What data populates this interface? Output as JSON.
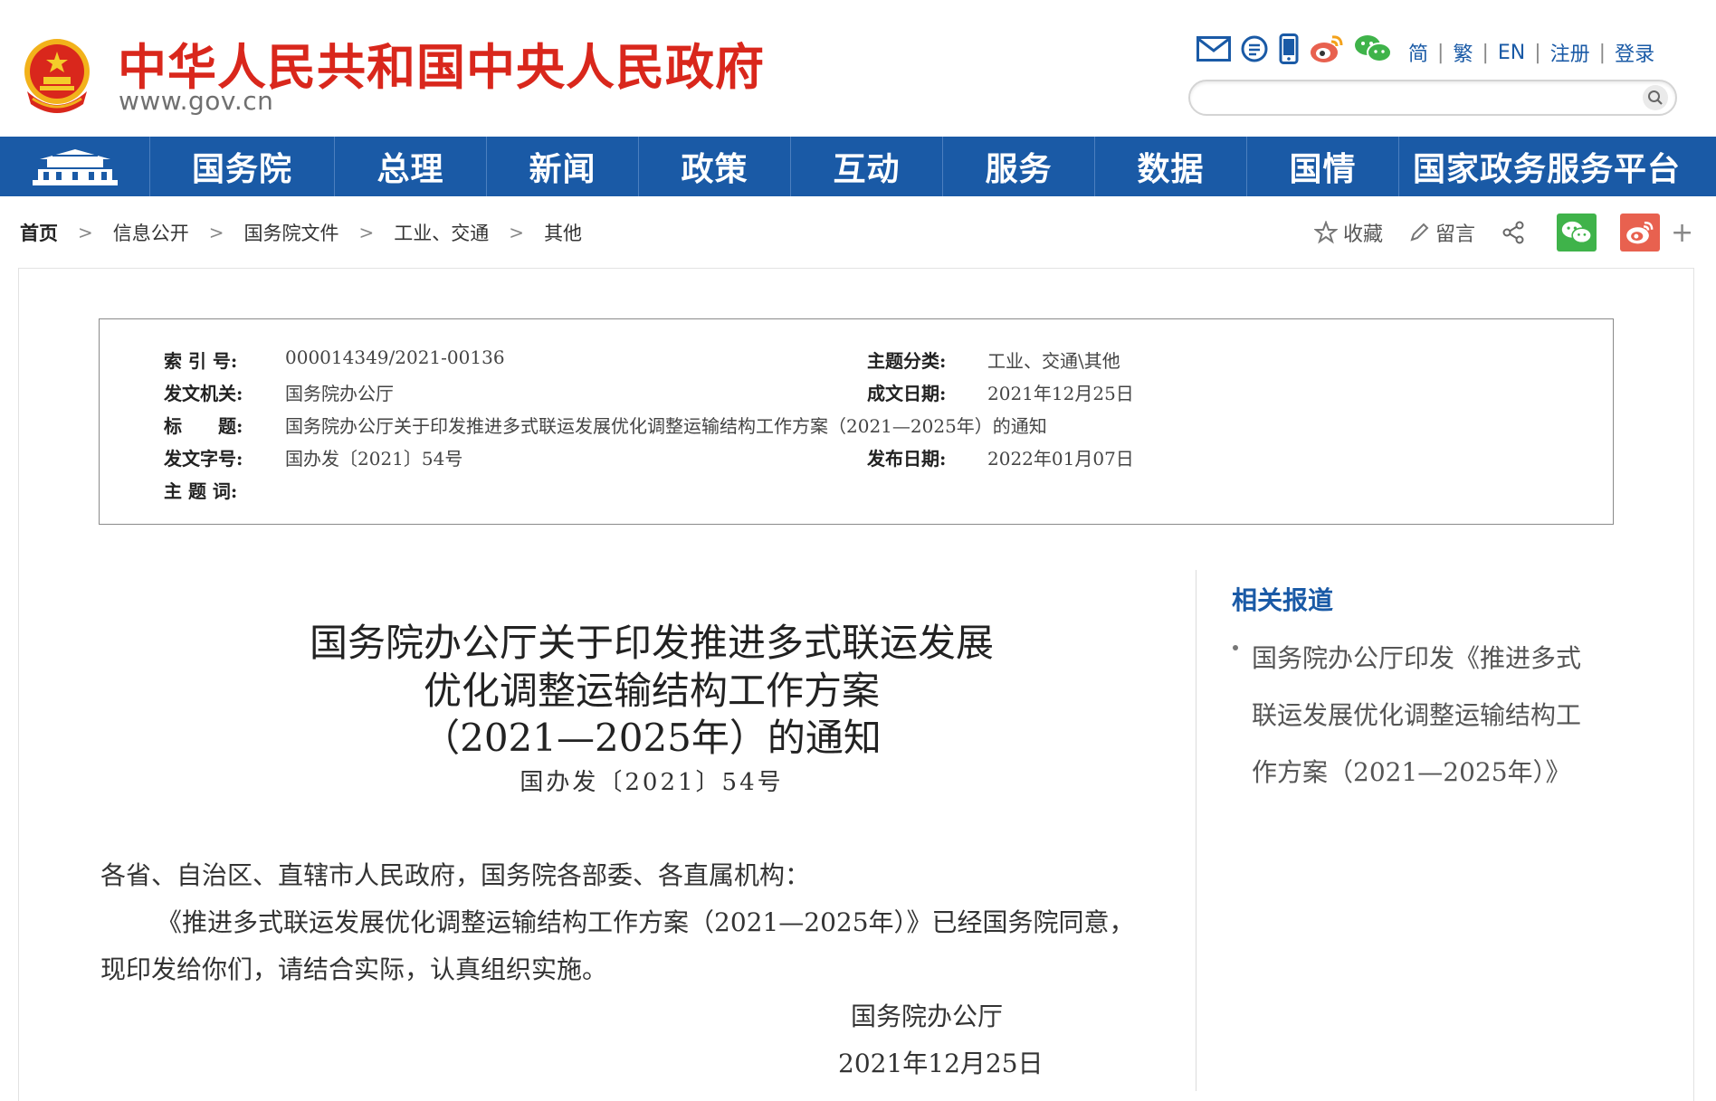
{
  "header": {
    "site_title": "中华人民共和国中央人民政府",
    "site_domain": "www.gov.cn",
    "icons": [
      "mail-icon",
      "message-icon",
      "mobile-icon",
      "weibo-icon",
      "wechat-icon"
    ],
    "lang_links": [
      "简",
      "繁",
      "EN"
    ],
    "register_label": "注册",
    "login_label": "登录",
    "search_placeholder": ""
  },
  "nav": {
    "items": [
      "国务院",
      "总理",
      "新闻",
      "政策",
      "互动",
      "服务",
      "数据",
      "国情",
      "国家政务服务平台"
    ]
  },
  "breadcrumb": {
    "items": [
      "首页",
      "信息公开",
      "国务院文件",
      "工业、交通",
      "其他"
    ]
  },
  "tools": {
    "favorite_label": "收藏",
    "comment_label": "留言",
    "plus_label": "+"
  },
  "meta": {
    "index_label": "索 引 号:",
    "index_value": "000014349/2021-00136",
    "topic_label": "主题分类:",
    "topic_value": "工业、交通\\其他",
    "issuer_label": "发文机关:",
    "issuer_value": "国务院办公厅",
    "written_label": "成文日期:",
    "written_value": "2021年12月25日",
    "title_label": "标　　题:",
    "title_value": "国务院办公厅关于印发推进多式联运发展优化调整运输结构工作方案（2021—2025年）的通知",
    "docno_label": "发文字号:",
    "docno_value": "国办发〔2021〕54号",
    "publish_label": "发布日期:",
    "publish_value": "2022年01月07日",
    "keywords_label": "主 题 词:",
    "keywords_value": ""
  },
  "document": {
    "title_line1": "国务院办公厅关于印发推进多式联运发展",
    "title_line2": "优化调整运输结构工作方案",
    "title_line3": "（2021—2025年）的通知",
    "doc_number": "国办发〔2021〕54号",
    "salutation": "各省、自治区、直辖市人民政府，国务院各部委、各直属机构：",
    "body_line1": "《推进多式联运发展优化调整运输结构工作方案（2021—2025年）》已经国务院同意，",
    "body_line2": "现印发给你们，请结合实际，认真组织实施。",
    "signer": "国务院办公厅",
    "sign_date": "2021年12月25日"
  },
  "related": {
    "title": "相关报道",
    "item_line1": "国务院办公厅印发《推进多式",
    "item_line2": "联运发展优化调整运输结构工",
    "item_line3": "作方案（2021—2025年）》"
  },
  "colors": {
    "brand_red": "#d9271c",
    "nav_blue": "#1a5aa6",
    "wechat_green": "#3fb34a",
    "weibo_red": "#e8614f"
  }
}
